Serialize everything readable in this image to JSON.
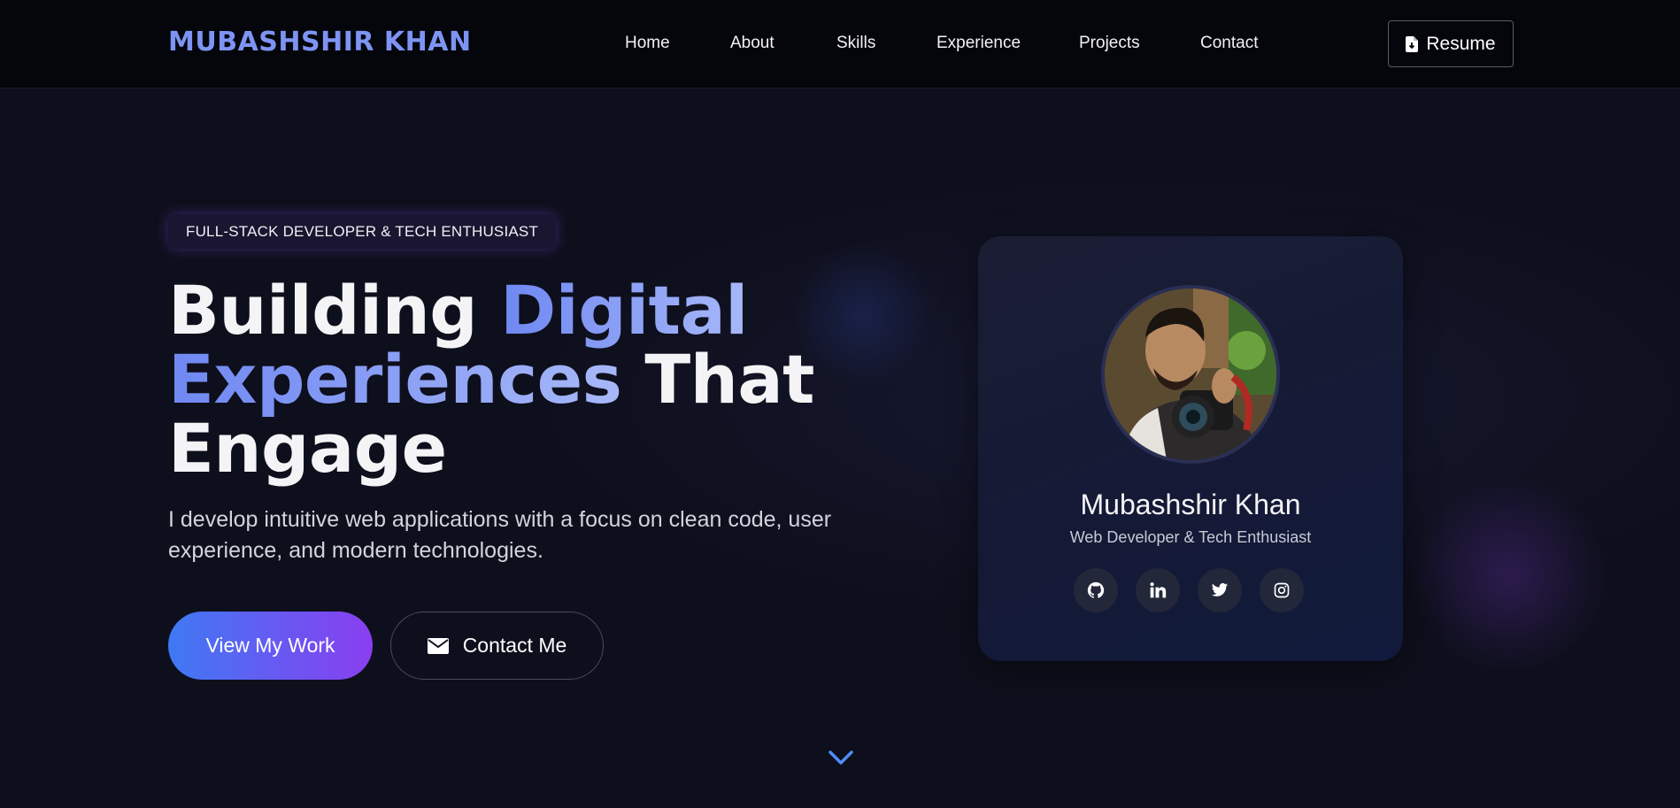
{
  "nav": {
    "logo": "MUBASHSHIR KHAN",
    "links": [
      "Home",
      "About",
      "Skills",
      "Experience",
      "Projects",
      "Contact"
    ],
    "resume_label": "Resume"
  },
  "hero": {
    "tagline": "FULL-STACK DEVELOPER & TECH ENTHUSIAST",
    "headline_part1": "Building ",
    "headline_accent1": "Digital",
    "headline_accent2": "Experiences",
    "headline_part2": " That",
    "headline_part3": "Engage",
    "intro": "I develop intuitive web applications with a focus on clean code, user experience, and modern technologies.",
    "primary_button": "View My Work",
    "secondary_button": "Contact Me"
  },
  "profile": {
    "name": "Mubashshir Khan",
    "role": "Web Developer & Tech Enthusiast",
    "socials": [
      "github-icon",
      "linkedin-icon",
      "twitter-icon",
      "instagram-icon"
    ]
  },
  "colors": {
    "accent": "#7d94f4",
    "gradient_start": "#3f79f3",
    "gradient_end": "#8a3ef0",
    "background": "#0e0f1c"
  }
}
